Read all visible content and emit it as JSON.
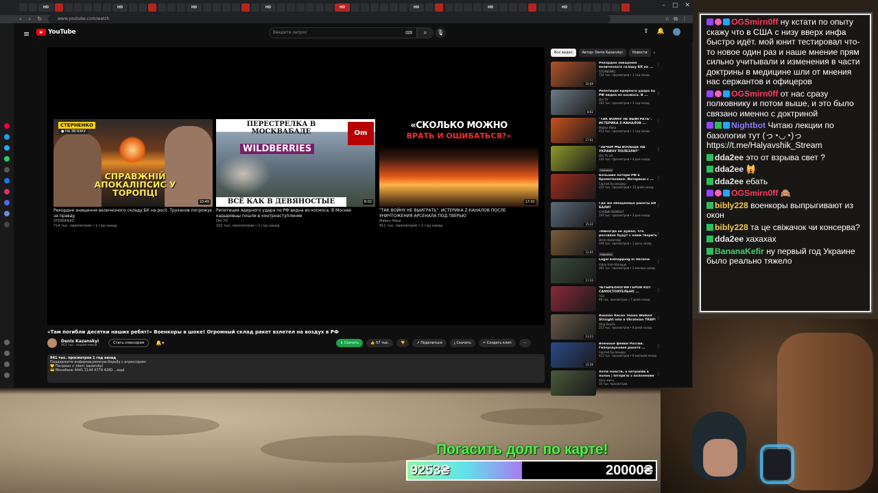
{
  "browser": {
    "url": "www.youtube.com/watch",
    "tab_labels": [
      "HD",
      "HD",
      "HD",
      "HD",
      "HD",
      "HD",
      "HD",
      "HD",
      "HD",
      "HD",
      "HD",
      "HD"
    ]
  },
  "youtube": {
    "logo": "YouTube",
    "search_placeholder": "Введите запрос",
    "endcards": [
      {
        "tag": "СТЕРНЕНКО",
        "tag2": "● НА ЗВ'ЯЗКУ",
        "overlay": "СПРАВЖНІЙ АПОКАЛІПСИС У ТОРОПЦІ",
        "duration": "10:49",
        "title": "Рекордне знищення величезного складу БК на росії. Труханов погрожує за правду",
        "channel": "STERNENKO",
        "meta": "714 тыс. просмотров • 1 год назад"
      },
      {
        "overlay_top": "ПЕРЕСТРЕЛКА В МОСКВАБАДЕ",
        "brand": "WILDBERRIES",
        "logo": "Om",
        "overlay_bottom": "ВСЁ КАК В ДЕВЯНОСТЫЕ",
        "duration": "8:02",
        "title": "Репетиция ядерного удара по РФ видна из космоса. В Москве кадыровцы пошли в контрнаступление",
        "channel": "Om TV",
        "meta": "162 тыс. просмотров • 1 год назад"
      },
      {
        "overlay_top": "«СКОЛЬКО МОЖНО",
        "overlay_red": "ВРАТЬ И ОШИБАТЬСЯ?»",
        "duration": "17:01",
        "title": "\"ТАК ВОЙНУ НЕ ВЫИГРАТЬ\". ИСТЕРИКА Z-КАНАЛОВ ПОСЛЕ УНИЧТОЖЕНИЯ АРСЕНАЛА ПОД ТВЕРЬЮ",
        "channel": "Майкл Наки",
        "meta": "911 тыс. просмотров • 1 год назад"
      }
    ],
    "video": {
      "title": "«Там погибли десятки наших ребят!» Военкоры в шоке! Огромный склад ракет взлетел на воздух в РФ",
      "channel": "Denis Kazanskyi",
      "subs": "901 тыс. подписчиков",
      "sponsor": "Стать спонсором",
      "download": "⬇ Скачать",
      "likes": "57 тыс.",
      "share": "Поделиться",
      "save": "Скачать",
      "clip": "Создать клип",
      "desc_line1": "941 тыс. просмотров  1 год назад",
      "desc_line2": "Поддержите информационную борьбу с агрессором:",
      "desc_line3": "💛 Патреон   ✔ /deni_kazanskyi",
      "desc_line4": "💳 Монобанк 4441 1144 4779 4260 ...ещё"
    },
    "chips": [
      "Все видео",
      "Автор: Denis Kazanskyi",
      "Новости"
    ],
    "recs": [
      {
        "title": "Рекордне знищення величезного складу БК на ...",
        "channel": "STERNENKO",
        "meta": "714 тыс. просмотров • 1 год назад",
        "dur": "10:49",
        "color": "#b0532a"
      },
      {
        "title": "Репетиция ядерного удара по РФ видна из космоса. В ...",
        "channel": "Om TV",
        "meta": "162 тыс. просмотров • 1 год назад",
        "dur": "8:02",
        "color": "#6c7a86"
      },
      {
        "title": "\"ТАК ВОЙНУ НЕ ВЫИГРАТЬ\". ИСТЕРИКА Z-КАНАЛОВ ...",
        "channel": "Майкл Наки",
        "meta": "911 тыс. просмотров • 1 год назад",
        "dur": "17:01",
        "color": "#c8501c"
      },
      {
        "title": "\"ЗАЧЕМ МЫ ВООБЩЕ НА УКРАИНУ ПОЛЕЗЛИ?\"",
        "channel": "Om TV UA",
        "meta": "135 тыс. просмотров • 4 дня назад",
        "new": "Новинка",
        "dur": "",
        "color": "#8f9a2a"
      },
      {
        "title": "Большие потери РФ в бронетехнике. Интервью с ...",
        "channel": "Сергей Ауслендер",
        "meta": "122 тыс. просмотров • 13 дней назад",
        "dur": "",
        "color": "#a03020"
      },
      {
        "title": "Где же обещанные ракеты ЕЙ БАЛИ?",
        "channel": "СЛАВИК МОМЕНТ",
        "meta": "197 тыс. просмотров • 2 дня назад",
        "dur": "15:22",
        "color": "#5a6a7a"
      },
      {
        "title": "«Никогда не думал, что россияне будут с нами творить ...",
        "channel": "Denis Kazanskyi",
        "meta": "344 тыс. просмотров • 1 день назад",
        "new": "Новинка",
        "dur": "12:45",
        "color": "#7a5a3a"
      },
      {
        "title": "Legal kidnapping in Ukraine",
        "channel": "Video from Mariupol",
        "meta": "381 тыс. просмотров • 2 месяца назад",
        "dur": "11:33",
        "color": "#3a4a3a"
      },
      {
        "title": "ЧЕТЫРЕХНОГИЙ ГЕРОЙ КОТ САМОСТОЯТЕЛЬНО ...",
        "channel": "ТСН",
        "meta": "68 тыс. просмотров • 7 дней назад",
        "dur": "",
        "color": "#8a2a3a"
      },
      {
        "title": "Russian Recon Teams Walked Straight into a Ukrainian TRAP!",
        "channel": "Oleg Reacts",
        "meta": "213 тыс. просмотров • 8 дней назад",
        "dur": "13:23",
        "color": "#6a5a4a"
      },
      {
        "title": "Военные фейки России. Гиперзвуковая ракета ...",
        "channel": "Сергей Ауслендер",
        "meta": "415 тыс. просмотров • 6 месяцев назад",
        "dur": "23:26",
        "color": "#2a4a8a"
      },
      {
        "title": "Хотів помсти, а потрапив в полон | Інтерв'ю з полоненим ...",
        "channel": "Хочу жить",
        "meta": "10 тыс. просмотров",
        "dur": "",
        "color": "#4a5a3a"
      }
    ]
  },
  "chat": [
    {
      "name": "OGSmirn0ff",
      "color": "#ff3b5c",
      "badges": [
        "tw",
        "ht",
        "bl"
      ],
      "text": "ну кстати по опыту скажу что в США с низу вверх инфа быстро идёт. мой юнит тестировал что-то новое один раз и наше мнение прям сильно учитывали и изменения в части доктрины в медицине шли от мнения нас сержантов и офицеров"
    },
    {
      "name": "OGSmirn0ff",
      "color": "#ff3b5c",
      "badges": [
        "tw",
        "ht",
        "bl"
      ],
      "text": "от нас сразу полковнику и потом выше, и это было связано именно с доктриной"
    },
    {
      "name": "Nightbot",
      "color": "#8a7cff",
      "badges": [
        "tw",
        "gr",
        "bl"
      ],
      "text": "Читаю лекции по базологии тут (っ◔◡◔)っ https://t.me/Halyavshik_Stream"
    },
    {
      "name": "dda2ee",
      "color": "#e8e8e8",
      "badges": [
        "gr"
      ],
      "text": "это от взрыва свет ?"
    },
    {
      "name": "dda2ee",
      "color": "#e8e8e8",
      "badges": [
        "gr"
      ],
      "text": "🙀"
    },
    {
      "name": "dda2ee",
      "color": "#e8e8e8",
      "badges": [
        "gr"
      ],
      "text": "ебать"
    },
    {
      "name": "OGSmirn0ff",
      "color": "#ff3b5c",
      "badges": [
        "tw",
        "ht",
        "bl"
      ],
      "text": "🙈"
    },
    {
      "name": "bibly228",
      "color": "#f7c94a",
      "badges": [
        "gr"
      ],
      "text": "военкоры выпрыгивают из окон"
    },
    {
      "name": "bibly228",
      "color": "#f7c94a",
      "badges": [
        "gr"
      ],
      "text": "та це свіжачок чи консерва?"
    },
    {
      "name": "dda2ee",
      "color": "#e8e8e8",
      "badges": [
        "gr"
      ],
      "text": "хахахах"
    },
    {
      "name": "BananaKefir",
      "color": "#42d16b",
      "badges": [
        "gr"
      ],
      "text": "ну первый год Украине было реально тяжело"
    }
  ],
  "donation": {
    "title": "Погасить долг по карте!",
    "current": "9253₴",
    "target": "20000₴",
    "progress": 0.4627
  }
}
